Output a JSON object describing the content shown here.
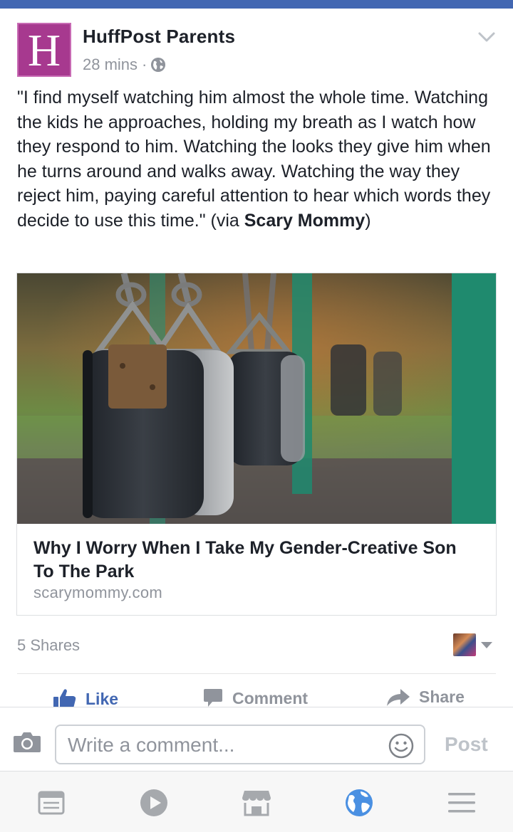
{
  "post": {
    "page_name": "HuffPost Parents",
    "logo_letter": "H",
    "time": "28 mins",
    "separator": "·",
    "text_main": "\"I find myself watching him almost the whole time. Watching the kids he approaches, holding my breath as I watch how they respond to him. Watching the looks they give him when he turns around and walks away. Watching the way they reject him, paying careful attention to hear which words they decide to use this time.\" (via ",
    "text_link": "Scary Mommy",
    "text_end": ")",
    "link": {
      "title": "Why I Worry When I Take My Gender-Creative Son To The Park",
      "domain": "scarymommy.com"
    },
    "shares": "5 Shares"
  },
  "actions": {
    "like": "Like",
    "comment": "Comment",
    "share": "Share"
  },
  "composer": {
    "placeholder": "Write a comment...",
    "post_label": "Post"
  },
  "tabs": [
    "news-feed-icon",
    "video-icon",
    "marketplace-icon",
    "notifications-globe-icon",
    "menu-icon"
  ],
  "colors": {
    "brand_blue": "#4267b2",
    "logo_purple": "#a7398f",
    "muted_gray": "#90949c"
  }
}
